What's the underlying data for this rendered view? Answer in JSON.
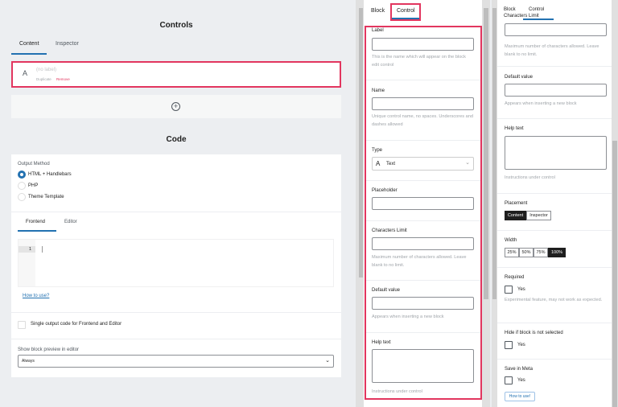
{
  "controls": {
    "title": "Controls",
    "tabs": [
      {
        "label": "Content",
        "active": true
      },
      {
        "label": "Inspector"
      }
    ],
    "item": {
      "icon": "text-a-icon",
      "label": "(no label)",
      "duplicate": "Duplicate",
      "remove": "Remove"
    },
    "add_icon": "plus-circle-icon"
  },
  "code": {
    "title": "Code",
    "output_method_label": "Output Method",
    "methods": [
      {
        "label": "HTML + Handlebars",
        "selected": true
      },
      {
        "label": "PHP"
      },
      {
        "label": "Theme Template"
      }
    ],
    "tabs": [
      {
        "label": "Frontend",
        "active": true
      },
      {
        "label": "Editor"
      }
    ],
    "line_number": "1",
    "how_to_use": "How to use?",
    "single_output": "Single output code for Frontend and Editor",
    "preview_label": "Show block preview in editor",
    "preview_value": "Always"
  },
  "middle": {
    "tabs": [
      "Block",
      "Control"
    ],
    "label": {
      "title": "Label",
      "help": "This is the name which will appear on the block edit control"
    },
    "name": {
      "title": "Name",
      "help": "Unique control name, no spaces. Underscores and dashes allowed"
    },
    "type": {
      "title": "Type",
      "value": "Text"
    },
    "placeholder": {
      "title": "Placeholder"
    },
    "chars": {
      "title": "Characters Limit",
      "help": "Maximum number of characters allowed. Leave blank to no limit."
    },
    "default": {
      "title": "Default value",
      "help": "Appears when inserting a new block"
    },
    "helptext": {
      "title": "Help text",
      "help": "Instructions under control"
    }
  },
  "right": {
    "tabs": [
      "Block",
      "Control"
    ],
    "chars_title": "Characters Limit",
    "chars_help": "Maximum number of characters allowed. Leave blank to no limit.",
    "default": {
      "title": "Default value",
      "help": "Appears when inserting a new block"
    },
    "helptext": {
      "title": "Help text",
      "help": "Instructions under control"
    },
    "placement": {
      "title": "Placement",
      "options": [
        "Content",
        "Inspector"
      ],
      "selected": "Content"
    },
    "width": {
      "title": "Width",
      "options": [
        "25%",
        "50%",
        "75%",
        "100%"
      ],
      "selected": "100%"
    },
    "required": {
      "title": "Required",
      "yes": "Yes",
      "help": "Experimental feature, may not work as expected."
    },
    "hide": {
      "title": "Hide if block is not selected",
      "yes": "Yes"
    },
    "meta": {
      "title": "Save in Meta",
      "yes": "Yes",
      "how": "How to use!"
    }
  },
  "colors": {
    "accent": "#2271b1",
    "highlight": "#e2365f",
    "dark": "#1e1e1e"
  }
}
